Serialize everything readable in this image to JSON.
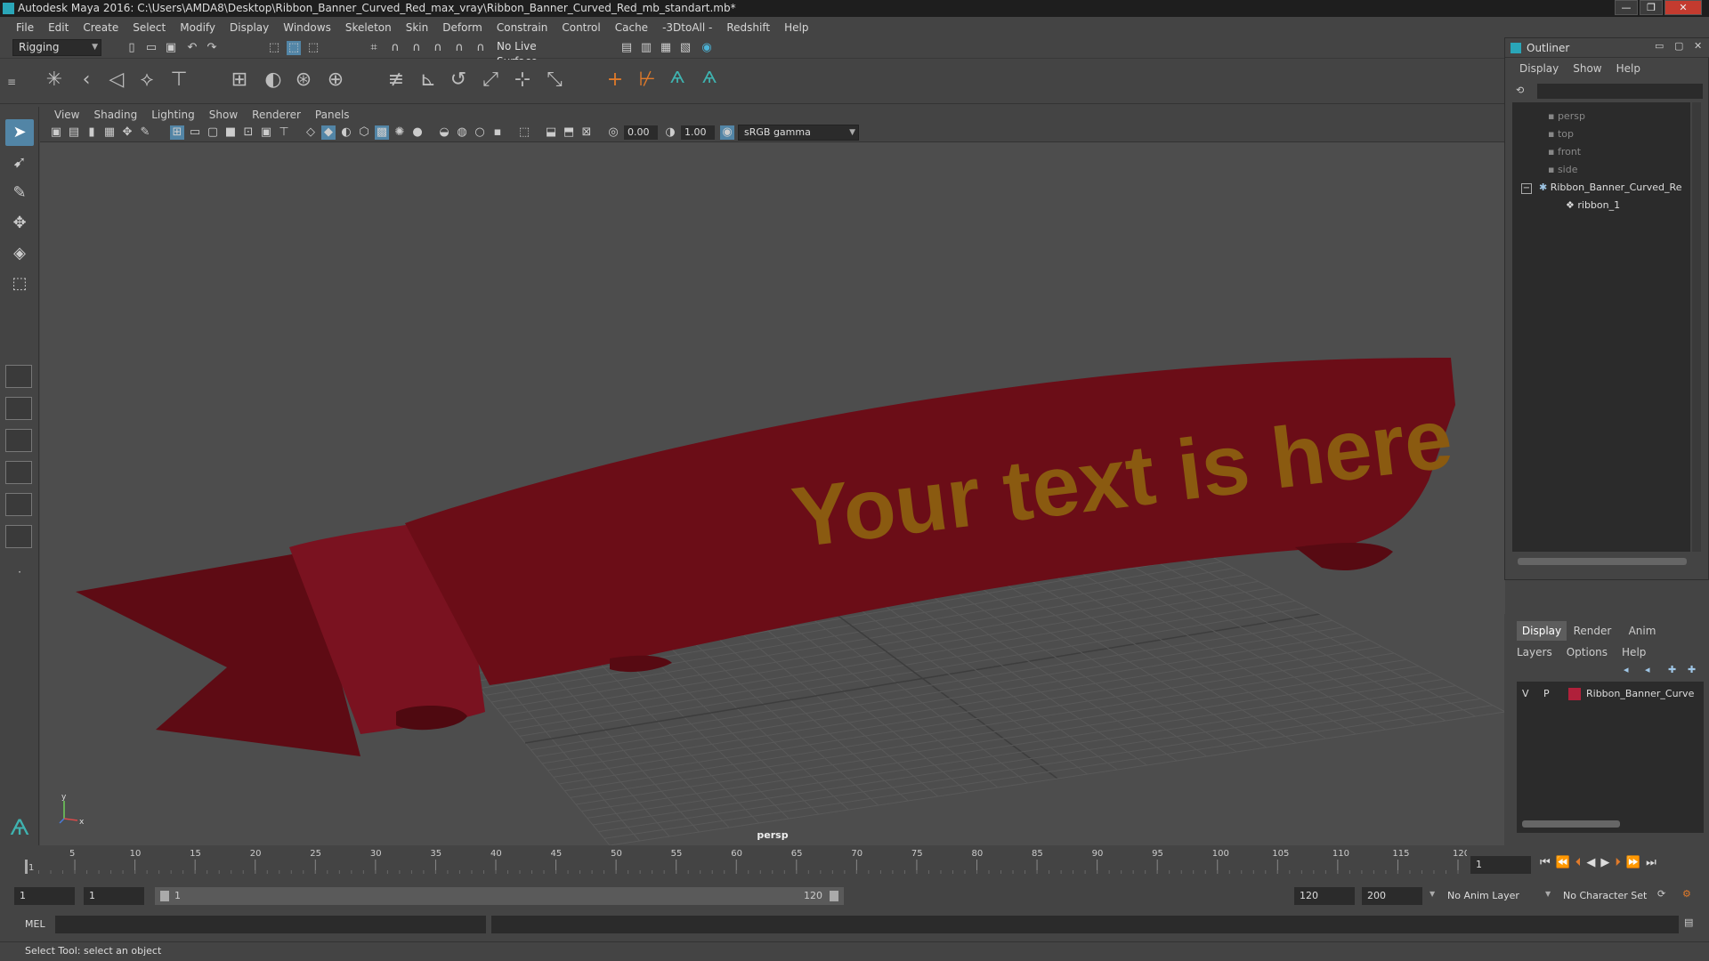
{
  "window": {
    "title": "Autodesk Maya 2016: C:\\Users\\AMDA8\\Desktop\\Ribbon_Banner_Curved_Red_max_vray\\Ribbon_Banner_Curved_Red_mb_standart.mb*",
    "minimize": "—",
    "maximize": "❐",
    "close": "✕"
  },
  "menubar": [
    "File",
    "Edit",
    "Create",
    "Select",
    "Modify",
    "Display",
    "Windows",
    "Skeleton",
    "Skin",
    "Deform",
    "Constrain",
    "Control",
    "Cache",
    "-3DtoAll -",
    "Redshift",
    "Help"
  ],
  "statusline": {
    "menu_set": "Rigging",
    "live_surface": "No Live Surface"
  },
  "viewport": {
    "menus": [
      "View",
      "Shading",
      "Lighting",
      "Show",
      "Renderer",
      "Panels"
    ],
    "exposure": "0.00",
    "gamma": "1.00",
    "color_space": "sRGB gamma",
    "camera": "persp",
    "banner_text": "Your text is here",
    "axis_y": "y",
    "axis_x": "x"
  },
  "outliner": {
    "title": "Outliner",
    "menus": [
      "Display",
      "Show",
      "Help"
    ],
    "items": [
      {
        "label": "persp",
        "dim": true
      },
      {
        "label": "top",
        "dim": true
      },
      {
        "label": "front",
        "dim": true
      },
      {
        "label": "side",
        "dim": true
      },
      {
        "label": "Ribbon_Banner_Curved_Re",
        "dim": false
      },
      {
        "label": "ribbon_1",
        "dim": false
      }
    ],
    "collapse_symbol": "−"
  },
  "layer_editor": {
    "tabs": [
      "Display",
      "Render",
      "Anim"
    ],
    "menus": [
      "Layers",
      "Options",
      "Help"
    ],
    "layer": {
      "v": "V",
      "p": "P",
      "name": "Ribbon_Banner_Curve",
      "color": "#b0203a"
    }
  },
  "timeline": {
    "ticks": [
      "1",
      "5",
      "10",
      "15",
      "20",
      "25",
      "30",
      "35",
      "40",
      "45",
      "50",
      "55",
      "60",
      "65",
      "70",
      "75",
      "80",
      "85",
      "90",
      "95",
      "100",
      "105",
      "110",
      "115",
      "120"
    ],
    "current_frame": "1"
  },
  "range": {
    "start": "1",
    "playback_start": "1",
    "slider_start": "1",
    "slider_end": "120",
    "playback_end": "120",
    "end": "200",
    "anim_layer": "No Anim Layer",
    "character_set": "No Character Set"
  },
  "cmdline": {
    "label": "MEL"
  },
  "helpline": {
    "text": "Select Tool: select an object"
  },
  "colors": {
    "accent": "#5285a6",
    "ribbon": "#6e0f18",
    "ribbon_text": "#8a5a10"
  }
}
